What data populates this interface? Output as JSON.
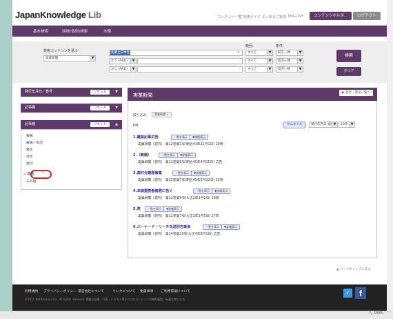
{
  "header": {
    "logo_main": "JapanKnowledge",
    "logo_sub": " Lib",
    "links": [
      "コンテンツ一覧",
      "ご利用ガイド",
      "よくあるご質問",
      "ENGLISH"
    ],
    "user_button": "コンテンツホルダ...",
    "logout_button": "ログアウト"
  },
  "nav": {
    "items": [
      "基本検索",
      "詳細(個別)検索",
      "本棚"
    ]
  },
  "search": {
    "content_label": "検索コンテンツを選ぶ",
    "content_select": "実業新聞",
    "term_label": "範囲:",
    "condition_label": "条件:",
    "keyword_value": "実業之日本社",
    "clear_x": "×",
    "op_rows": [
      {
        "op": "かつ (AND)",
        "value": ""
      },
      {
        "op": "かつ (AND)",
        "value": ""
      }
    ],
    "range_options": [
      "すべて",
      "すべて",
      "すべて"
    ],
    "condition_options": [
      "前方一致",
      "前方一致",
      "前方一致"
    ],
    "search_button": "検索",
    "clear_button": "クリア"
  },
  "sidebar": {
    "section1": {
      "title": "発行年月日／巻号",
      "reset": "リセット",
      "chevron": "▼"
    },
    "section2": {
      "title": "記事欄",
      "reset": "リセット",
      "chevron": "▼"
    },
    "section3": {
      "title": "記事種",
      "reset": "リセット",
      "chevron": "▲"
    },
    "items": [
      "表紙",
      "表紙・目次",
      "目次",
      "本文",
      "奥付",
      "✓ 広告",
      "その他"
    ],
    "highlight_count": "①"
  },
  "results": {
    "title": "実業新聞",
    "doc_list_link": "▶ 刊行・巻号一覧へ",
    "filter_label": "絞り込み:",
    "filter_tag": "実業新聞 ×",
    "count": "6件",
    "thumbnail_button": "サムネイル",
    "sort_select": "発行年月日 昇順",
    "per_page_select": "20件",
    "tags": [
      "一覧を表示",
      "▼詳細表示"
    ],
    "items": [
      {
        "num": "1.",
        "title": "雑誌記事広告",
        "meta": "実業新聞〔週刊〕 第12巻第1号(明治43年11月1日) 29頁"
      },
      {
        "num": "2.",
        "title": "〔無題〕",
        "meta": "実業新聞〔週刊〕 第12巻第6号(明治45年4月15日) 広告"
      },
      {
        "num": "3.",
        "title": "高村光雲彫像集",
        "meta": "実業新聞〔週刊〕 第12巻第7号(明治45年5月22日) 13頁"
      },
      {
        "num": "4.",
        "title": "本誌愛読者諸君に告ぐ",
        "meta": "実業新聞〔週刊〕 第12巻第9号(大正2年3月1日) 18頁"
      },
      {
        "num": "5.",
        "title": "茶",
        "meta": "実業新聞〔週刊〕 第12巻第7号(大正2年5月5日) 27頁"
      },
      {
        "num": "6.",
        "title": "バーナード・リーチ氏送別古楽会",
        "meta": "実業新聞〔週刊〕 第14巻第10号(大正4年8月1日) 広告"
      }
    ],
    "page_top": "▲ ページのトップに戻る"
  },
  "footer": {
    "links": [
      "利用規約",
      "プライバシーポリシー",
      "運営会社について",
      "リンクについて",
      "免責事項",
      "ご利用環境について"
    ],
    "copyright": "©2015 NetAdvance Inc. All rights reserved. 掲載の記事・写真・イラスト等すべてのコンテンツの無断複製・転載を禁じます。",
    "twitter_glyph": "✓",
    "facebook_glyph": "f"
  },
  "browser": {
    "zoom": "🔍 100%"
  }
}
